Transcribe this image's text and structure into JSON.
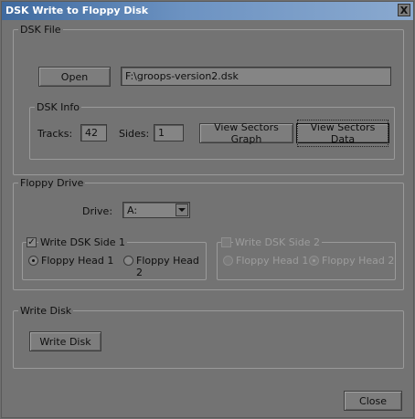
{
  "window": {
    "title": "DSK Write to Floppy Disk",
    "close_glyph": "X"
  },
  "dsk_file": {
    "group_label": "DSK File",
    "open_label": "Open",
    "path_value": "F:\\groops-version2.dsk",
    "info": {
      "group_label": "DSK Info",
      "tracks_label": "Tracks:",
      "tracks_value": "42",
      "sides_label": "Sides:",
      "sides_value": "1",
      "graph_label": "View Sectors Graph",
      "data_label": "View Sectors Data"
    }
  },
  "floppy_drive": {
    "group_label": "Floppy Drive",
    "drive_label": "Drive:",
    "drive_value": "A:",
    "side1": {
      "label": "Write DSK Side 1",
      "checked": true,
      "head1_label": "Floppy Head 1",
      "head2_label": "Floppy Head 2",
      "selected": "Floppy Head 1"
    },
    "side2": {
      "label": "Write DSK Side 2",
      "checked": false,
      "enabled": false,
      "head1_label": "Floppy Head 1",
      "head2_label": "Floppy Head 2",
      "selected": "Floppy Head 2"
    }
  },
  "write_disk": {
    "group_label": "Write Disk",
    "button_label": "Write Disk"
  },
  "footer": {
    "close_label": "Close"
  },
  "icons": {
    "check_glyph": "✓",
    "dropdown_icon": "chevron-down-icon"
  },
  "colors": {
    "titlebar_start": "#3f6a9f",
    "titlebar_end": "#8aa9cf",
    "window_bg": "#737373"
  }
}
